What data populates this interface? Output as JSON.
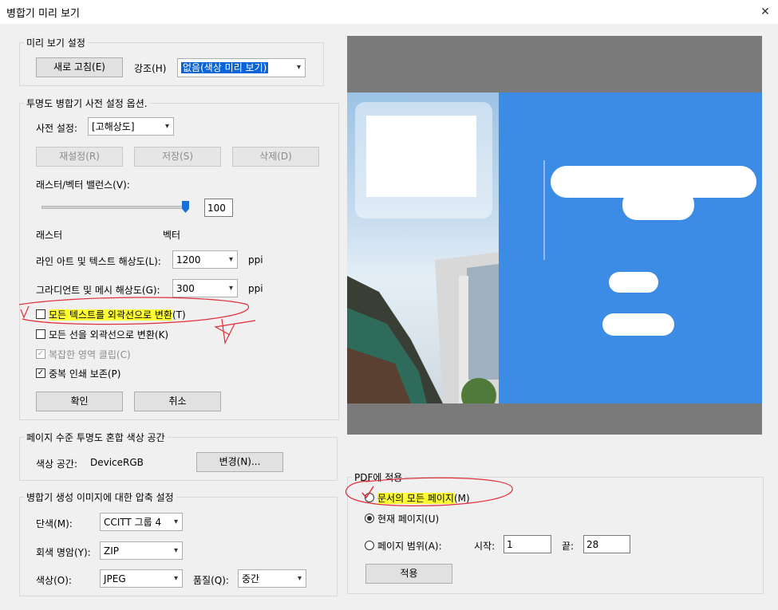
{
  "window": {
    "title": "병합기 미리 보기",
    "close_glyph": "✕"
  },
  "preview_settings": {
    "group_title": "미리 보기 설정",
    "refresh_label": "새로 고침(E)",
    "highlight_label": "강조(H)",
    "highlight_value": "없음(색상 미리 보기)"
  },
  "preset_options": {
    "group_title": "투명도 병합기 사전 설정 옵션.",
    "preset_label": "사전 설정:",
    "preset_value": "[고해상도]",
    "reset_label": "재설정(R)",
    "save_label": "저장(S)",
    "delete_label": "삭제(D)",
    "balance_label": "래스터/벡터 밸런스(V):",
    "balance_value": "100",
    "balance_fraction": 1.0,
    "raster_label": "래스터",
    "vector_label": "벡터",
    "line_art_label": "라인 아트 및 텍스트 해상도(L):",
    "line_art_value": "1200",
    "gradient_label": "그라디언트 및 메시 해상도(G):",
    "gradient_value": "300",
    "ppi": "ppi",
    "text_outline_label": "모든 텍스트를 외곽선으로 변환",
    "text_outline_suffix": "(T)",
    "stroke_outline_label": "모든 선을 외곽선으로 변환(K)",
    "clip_label": "복잡한 영역 클립(C)",
    "overprint_label": "중복 인쇄 보존(P)",
    "ok_label": "확인",
    "cancel_label": "취소"
  },
  "blend_space": {
    "group_title": "페이지 수준 투명도 혼합 색상 공간",
    "color_space_label": "색상 공간:",
    "color_space_value": "DeviceRGB",
    "change_label": "변경(N)..."
  },
  "compression": {
    "group_title": "병합기 생성 이미지에 대한 압축 설정",
    "mono_label": "단색(M):",
    "mono_value": "CCITT 그룹 4",
    "gray_label": "회색 명암(Y):",
    "gray_value": "ZIP",
    "color_label": "색상(O):",
    "color_value": "JPEG",
    "quality_label": "품질(Q):",
    "quality_value": "중간"
  },
  "apply_pdf": {
    "group_title": "PDF에 적용",
    "all_pages_label": "문서의 모든 페이지",
    "all_pages_suffix": "(M)",
    "current_page_label": "현재 페이지(U)",
    "range_label": "페이지 범위(A):",
    "start_label": "시작:",
    "start_value": "1",
    "end_label": "끝:",
    "end_value": "28",
    "apply_label": "적용"
  },
  "colors": {
    "accent_blue": "#3c8ce6",
    "preview_gray": "#7a7a7a",
    "highlight_yellow": "#ffff33",
    "annotation_red": "#e0303a"
  },
  "icons": {
    "dropdown": "chevron-down-icon",
    "close": "close-icon",
    "check": "check-icon"
  }
}
